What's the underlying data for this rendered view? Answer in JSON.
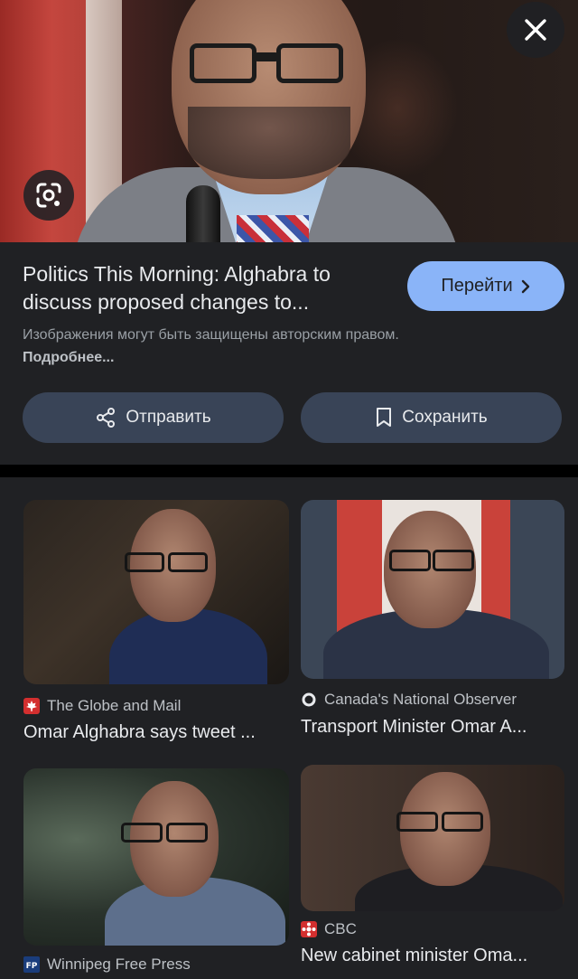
{
  "hero": {
    "close_icon": "close-icon",
    "lens_icon": "google-lens-icon"
  },
  "result": {
    "title": "Politics This Morning: Alghabra to discuss proposed changes to...",
    "visit_label": "Перейти",
    "copyright_text": "Изображения могут быть защищены авторским правом.",
    "copyright_link": "Подробнее...",
    "share_label": "Отправить",
    "save_label": "Сохранить"
  },
  "colors": {
    "accent": "#8ab4f8",
    "background": "#202124",
    "button_bg": "#394457"
  },
  "related": [
    {
      "source": "The Globe and Mail",
      "caption": "Omar Alghabra says tweet ...",
      "favicon": "maple-leaf-icon"
    },
    {
      "source": "Canada's National Observer",
      "caption": "Transport Minister Omar A...",
      "favicon": "ring-icon"
    },
    {
      "source": "Winnipeg Free Press",
      "caption": "",
      "favicon": "fp-icon"
    },
    {
      "source": "CBC",
      "caption": "New cabinet minister Oma...",
      "favicon": "cbc-gem-icon"
    }
  ]
}
